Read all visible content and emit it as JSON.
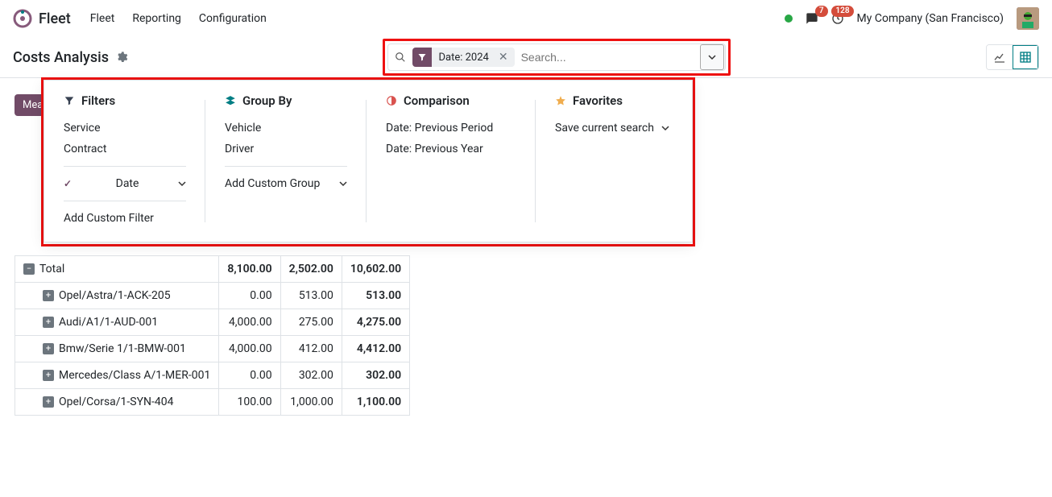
{
  "header": {
    "app_name": "Fleet",
    "nav": {
      "fleet": "Fleet",
      "reporting": "Reporting",
      "configuration": "Configuration"
    },
    "chat_badge": "7",
    "activity_badge": "128",
    "company": "My Company (San Francisco)"
  },
  "page": {
    "title": "Costs Analysis"
  },
  "search": {
    "chip_label": "Date: 2024",
    "placeholder": "Search..."
  },
  "measures_pill": "Mea",
  "dropdown": {
    "filters": {
      "title": "Filters",
      "service": "Service",
      "contract": "Contract",
      "date": "Date",
      "add_custom": "Add Custom Filter"
    },
    "groupby": {
      "title": "Group By",
      "vehicle": "Vehicle",
      "driver": "Driver",
      "add_custom": "Add Custom Group"
    },
    "comparison": {
      "title": "Comparison",
      "prev_period": "Date: Previous Period",
      "prev_year": "Date: Previous Year"
    },
    "favorites": {
      "title": "Favorites",
      "save": "Save current search"
    }
  },
  "table": {
    "total_label": "Total",
    "rows": [
      {
        "label": "Total",
        "c1": "8,100.00",
        "c2": "2,502.00",
        "c3": "10,602.00",
        "is_total": true
      },
      {
        "label": "Opel/Astra/1-ACK-205",
        "c1": "0.00",
        "c2": "513.00",
        "c3": "513.00"
      },
      {
        "label": "Audi/A1/1-AUD-001",
        "c1": "4,000.00",
        "c2": "275.00",
        "c3": "4,275.00"
      },
      {
        "label": "Bmw/Serie 1/1-BMW-001",
        "c1": "4,000.00",
        "c2": "412.00",
        "c3": "4,412.00"
      },
      {
        "label": "Mercedes/Class A/1-MER-001",
        "c1": "0.00",
        "c2": "302.00",
        "c3": "302.00"
      },
      {
        "label": "Opel/Corsa/1-SYN-404",
        "c1": "100.00",
        "c2": "1,000.00",
        "c3": "1,100.00"
      }
    ]
  }
}
